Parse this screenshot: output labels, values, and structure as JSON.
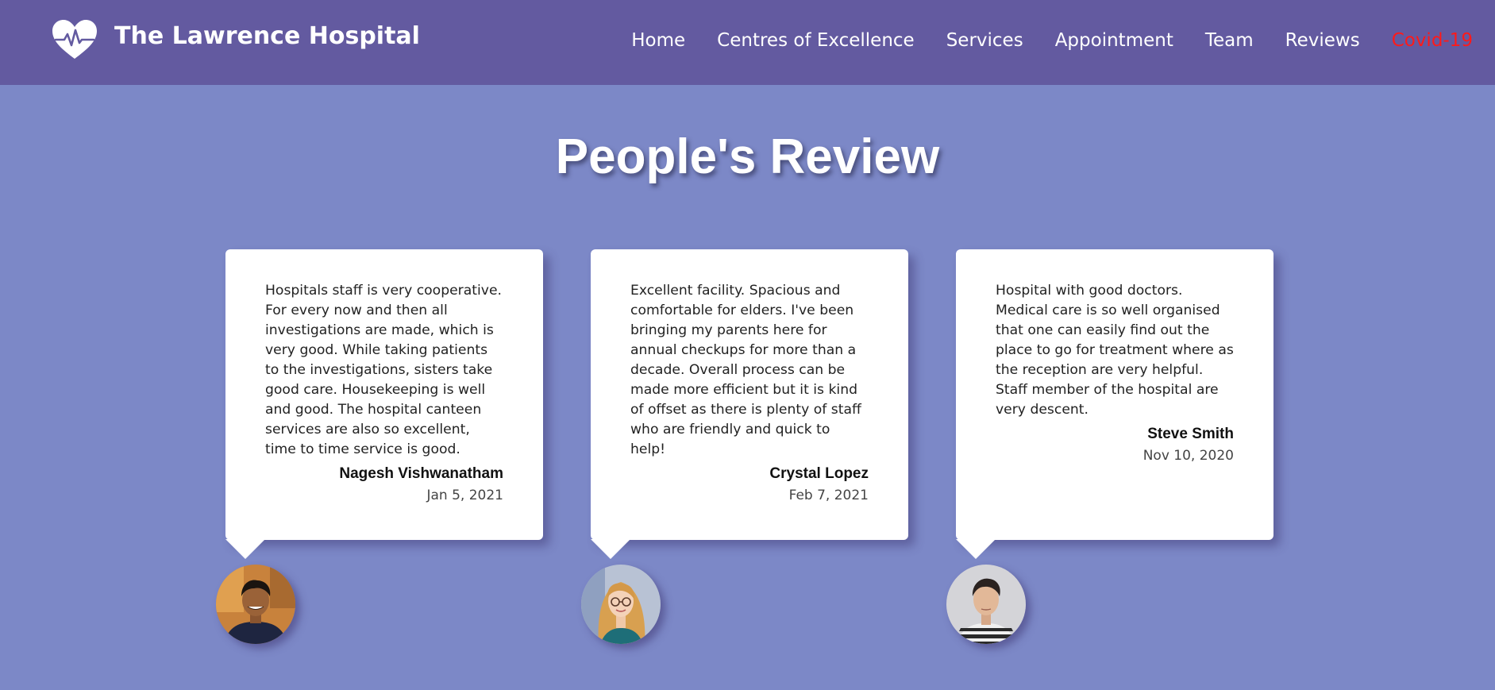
{
  "brand": {
    "title": "The Lawrence Hospital",
    "logo_icon": "heart-pulse-icon"
  },
  "nav": {
    "items": [
      {
        "label": "Home"
      },
      {
        "label": "Centres of Excellence"
      },
      {
        "label": "Services"
      },
      {
        "label": "Appointment"
      },
      {
        "label": "Team"
      },
      {
        "label": "Reviews"
      },
      {
        "label": "Covid-19"
      }
    ]
  },
  "section": {
    "title": "People's Review"
  },
  "reviews": [
    {
      "text": "Hospitals staff is very cooperative. For every now and then all investigations are made, which is very good. While taking patients to the investigations, sisters take good care. Housekeeping is well and good. The hospital canteen services are also so excellent, time to time service is good.",
      "author": "Nagesh Vishwanatham",
      "date": "Jan 5, 2021"
    },
    {
      "text": "Excellent facility. Spacious and comfortable for elders. I've been bringing my parents here for annual checkups for more than a decade. Overall process can be made more efficient but it is kind of offset as there is plenty of staff who are friendly and quick to help!",
      "author": "Crystal Lopez",
      "date": "Feb 7, 2021"
    },
    {
      "text": "Hospital with good doctors. Medical care is so well organised that one can easily find out the place to go for treatment where as the reception are very helpful. Staff member of the hospital are very descent.",
      "author": "Steve Smith",
      "date": "Nov 10, 2020"
    }
  ],
  "colors": {
    "navbar_bg": "#635aa0",
    "page_bg": "#7c88c7",
    "covid_link": "#ff1a1a",
    "card_bg": "#ffffff"
  }
}
